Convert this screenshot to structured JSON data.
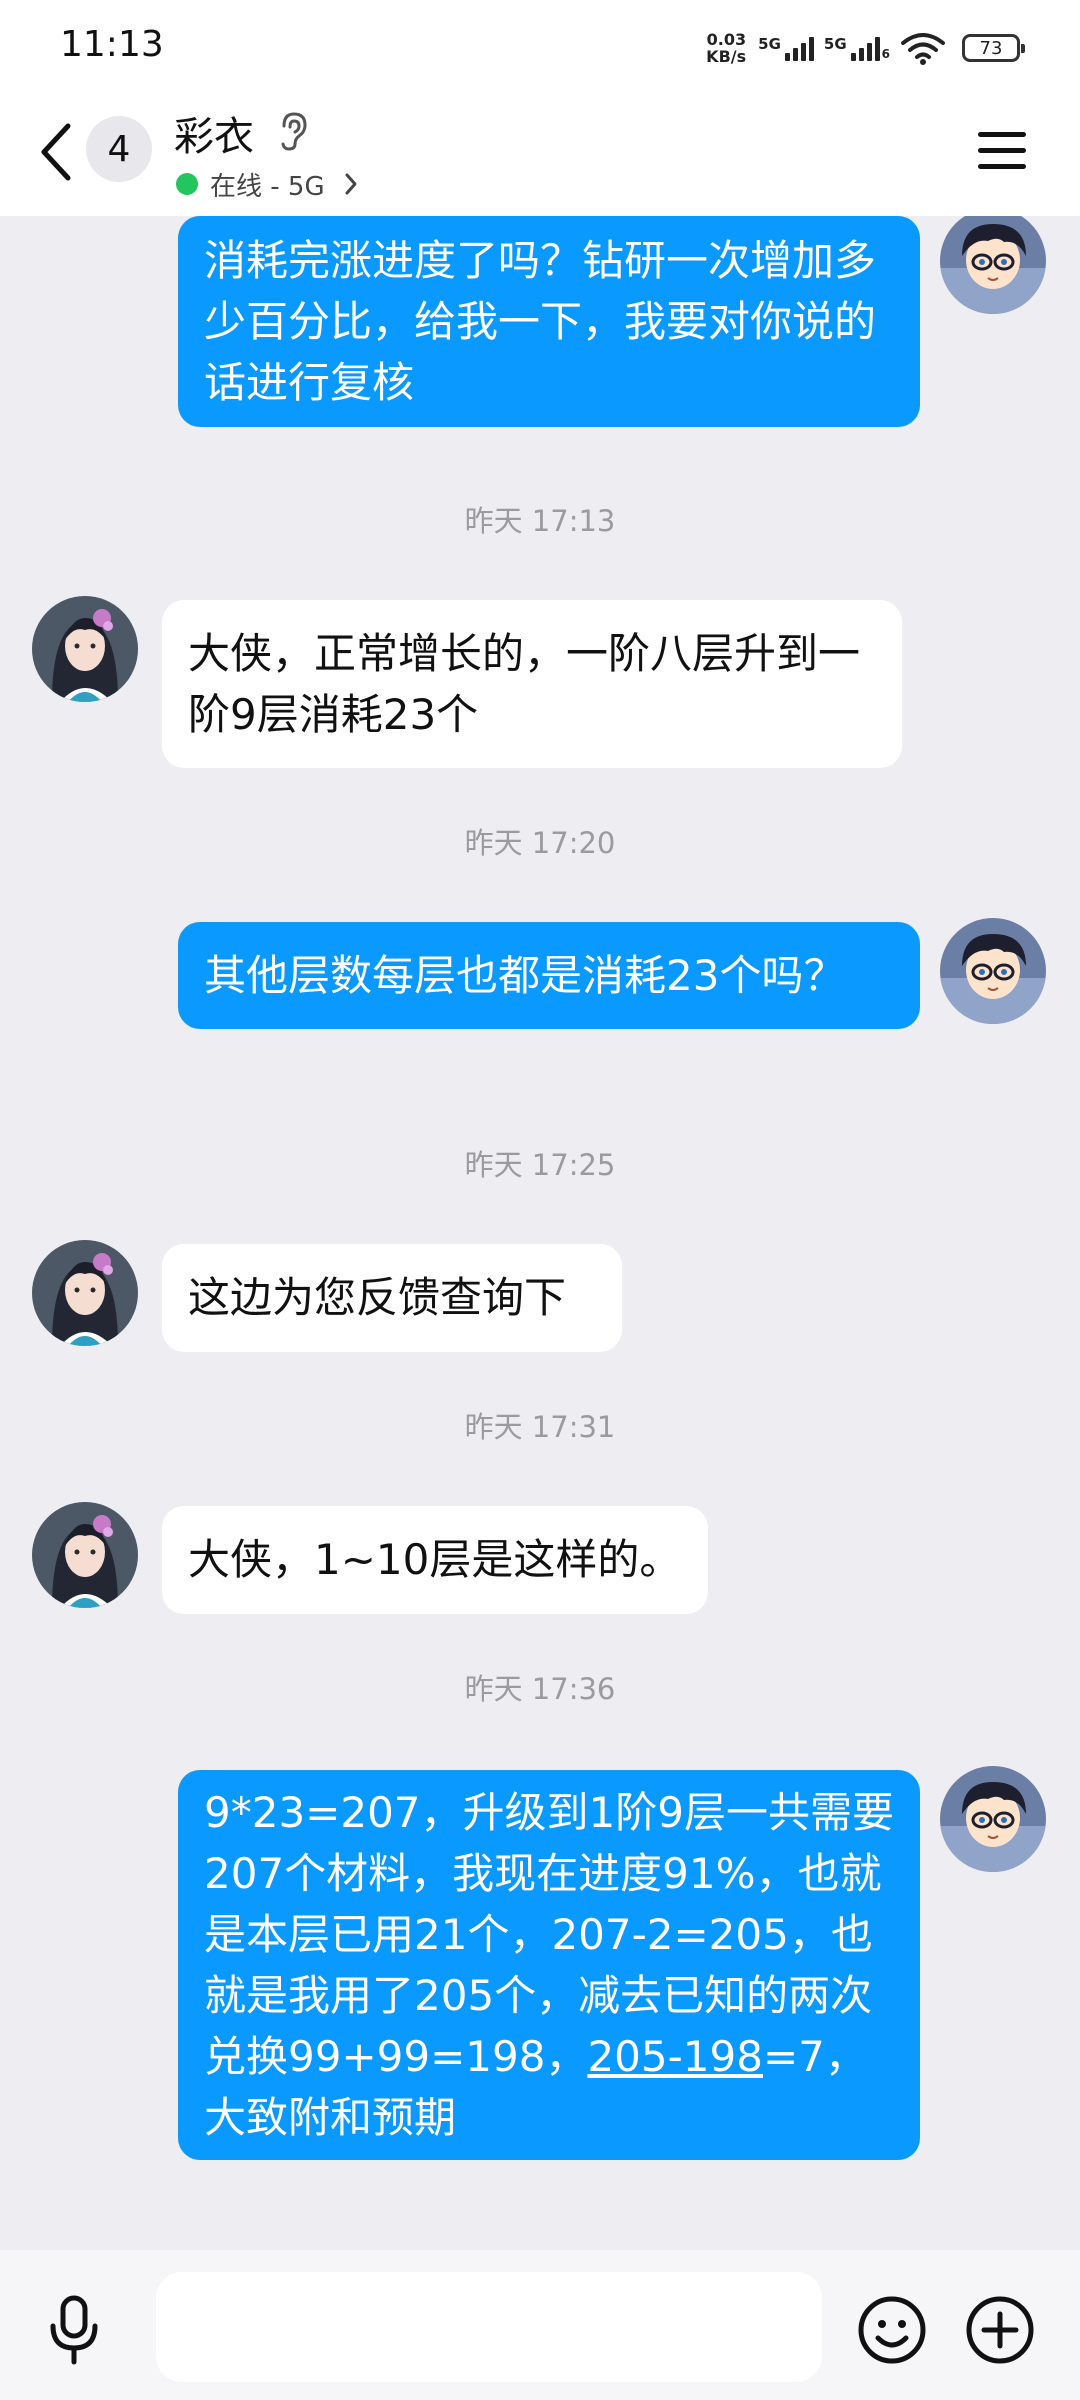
{
  "status_bar": {
    "time": "11:13",
    "net_speed_value": "0.03",
    "net_speed_unit": "KB/s",
    "signal_1_label": "5G",
    "signal_2_label": "5G",
    "signal_2_sub": "6",
    "battery": "73"
  },
  "header": {
    "unread_count": "4",
    "contact_name": "彩衣",
    "online_status": "在线 - 5G"
  },
  "messages": [
    {
      "direction": "out",
      "parts": [
        {
          "text": "消耗完涨进度了吗？钻研一次增加多少百分比，给我一下，我要对你说的话进行复核"
        }
      ]
    },
    {
      "direction": "in",
      "parts": [
        {
          "text": "大侠，正常增长的，一阶八层升到一阶9层消耗23个"
        }
      ]
    },
    {
      "direction": "out",
      "parts": [
        {
          "text": "其他层数每层也都是消耗23个吗？"
        }
      ]
    },
    {
      "direction": "in",
      "parts": [
        {
          "text": "这边为您反馈查询下"
        }
      ]
    },
    {
      "direction": "in",
      "parts": [
        {
          "text": "大侠，1~10层是这样的。"
        }
      ]
    },
    {
      "direction": "out",
      "parts": [
        {
          "text": "9*23=207，升级到1阶9层一共需要207个材料，我现在进度91%，也就是本层已用21个，207-2=205，也就是我用了205个，减去已知的两次兑换99+99=198，"
        },
        {
          "text": "205-198",
          "underline": true
        },
        {
          "text": "=7，大致附和预期"
        }
      ]
    }
  ],
  "timestamps": [
    "昨天 17:13",
    "昨天 17:20",
    "昨天 17:25",
    "昨天 17:31",
    "昨天 17:36"
  ],
  "input": {
    "value": "",
    "placeholder": ""
  },
  "colors": {
    "outgoing_bubble": "#0a99ff",
    "incoming_bubble": "#ffffff",
    "chat_background": "#eeeef2",
    "online_dot": "#22c55e"
  },
  "icons": {
    "back": "chevron-left-icon",
    "ear": "ear-icon",
    "menu": "hamburger-menu-icon",
    "mic": "microphone-icon",
    "emoji": "smiley-icon",
    "plus": "plus-circle-icon"
  }
}
